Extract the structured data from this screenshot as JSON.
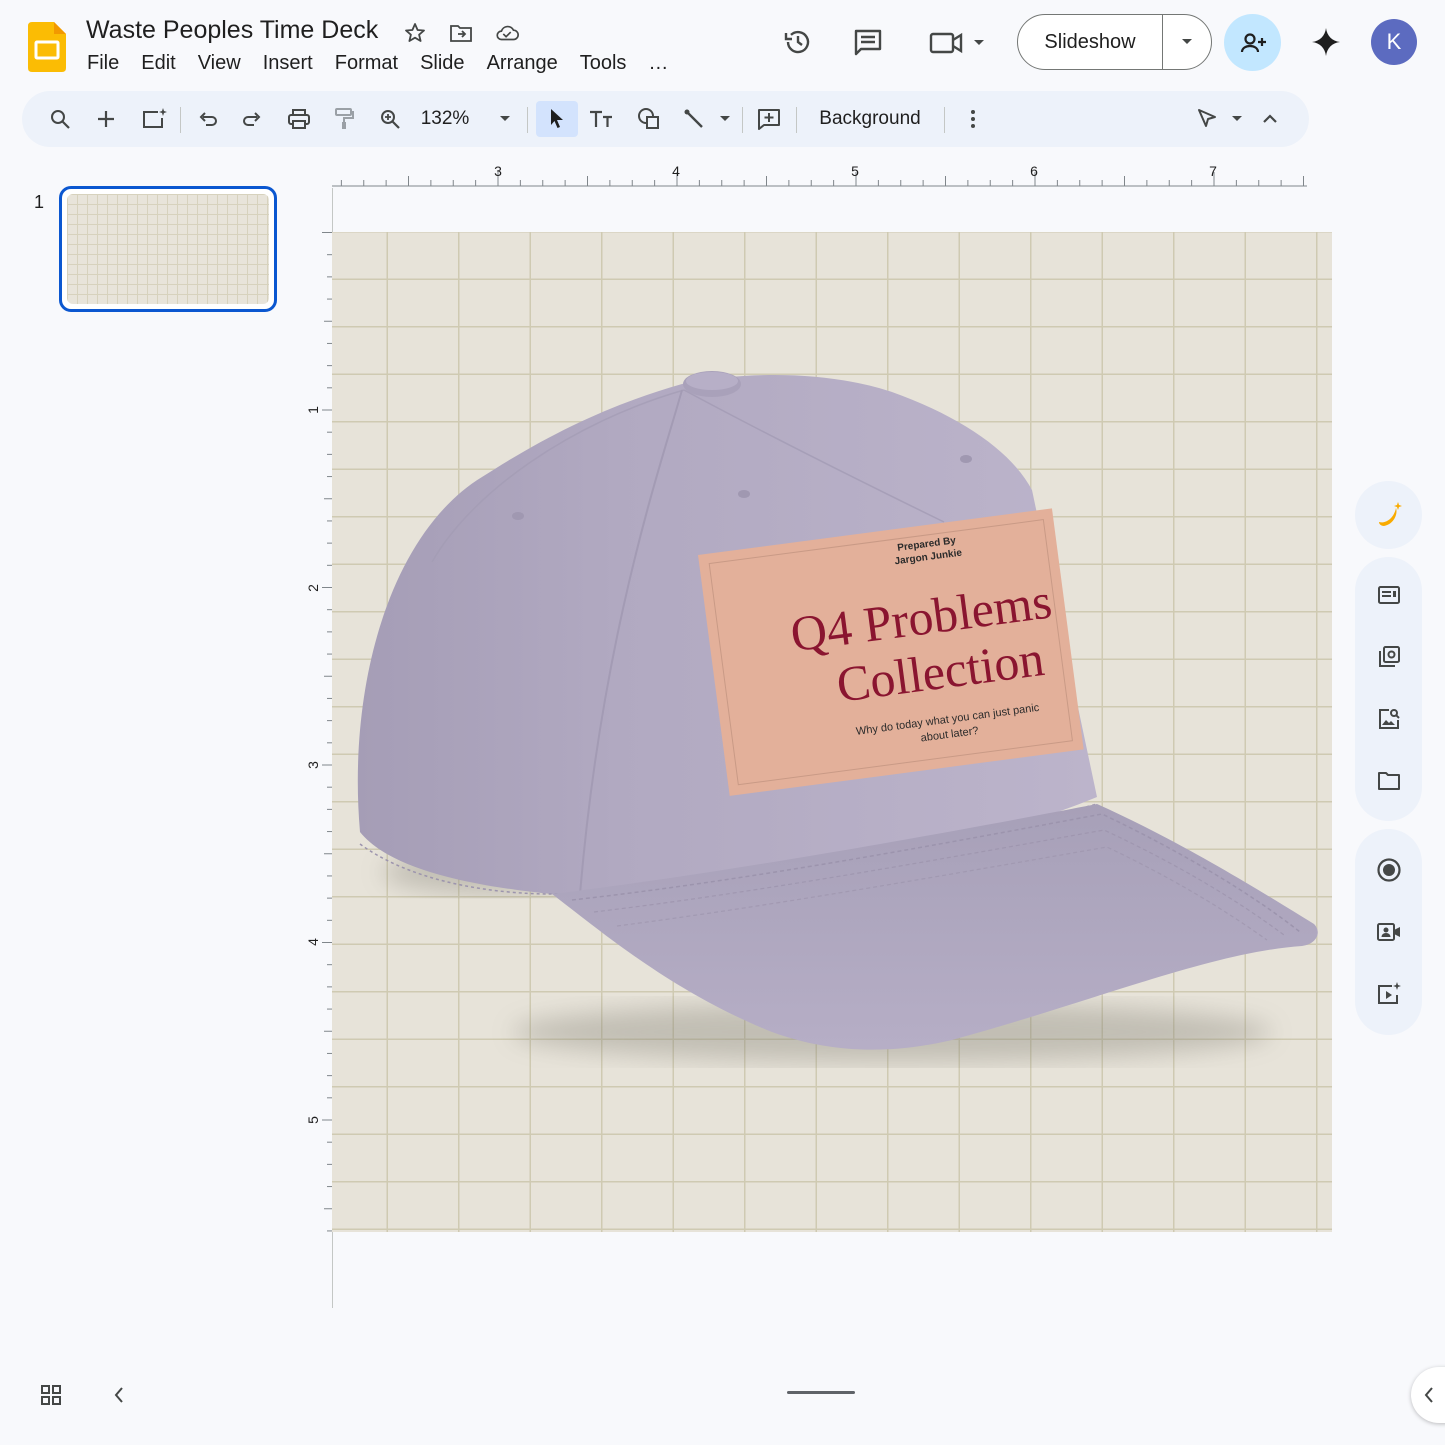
{
  "app": {
    "doc_title": "Waste Peoples Time Deck",
    "menu": [
      "File",
      "Edit",
      "View",
      "Insert",
      "Format",
      "Slide",
      "Arrange",
      "Tools",
      "…"
    ],
    "slideshow_label": "Slideshow",
    "avatar_initial": "K"
  },
  "toolbar": {
    "zoom": "132%",
    "background_label": "Background"
  },
  "filmstrip": {
    "slides": [
      {
        "number": "1"
      }
    ]
  },
  "rulers": {
    "horizontal_labels": [
      "3",
      "4",
      "5",
      "6",
      "7"
    ],
    "vertical_labels": [
      "1",
      "2",
      "3",
      "4",
      "5"
    ]
  },
  "slide": {
    "patch": {
      "prepared_by": "Prepared By",
      "author": "Jargon Junkie",
      "title_line1": "Q4 Problems",
      "title_line2": "Collection",
      "subtitle_line1": "Why do today what you can just panic",
      "subtitle_line2": "about later?"
    }
  },
  "colors": {
    "accent": "#0b57d0",
    "cap": "#b3abc3",
    "patch": "#e3b09a",
    "patch_title": "#8a1530",
    "canvas_bg": "#e7e3d9",
    "grid": "#cfcab2"
  }
}
